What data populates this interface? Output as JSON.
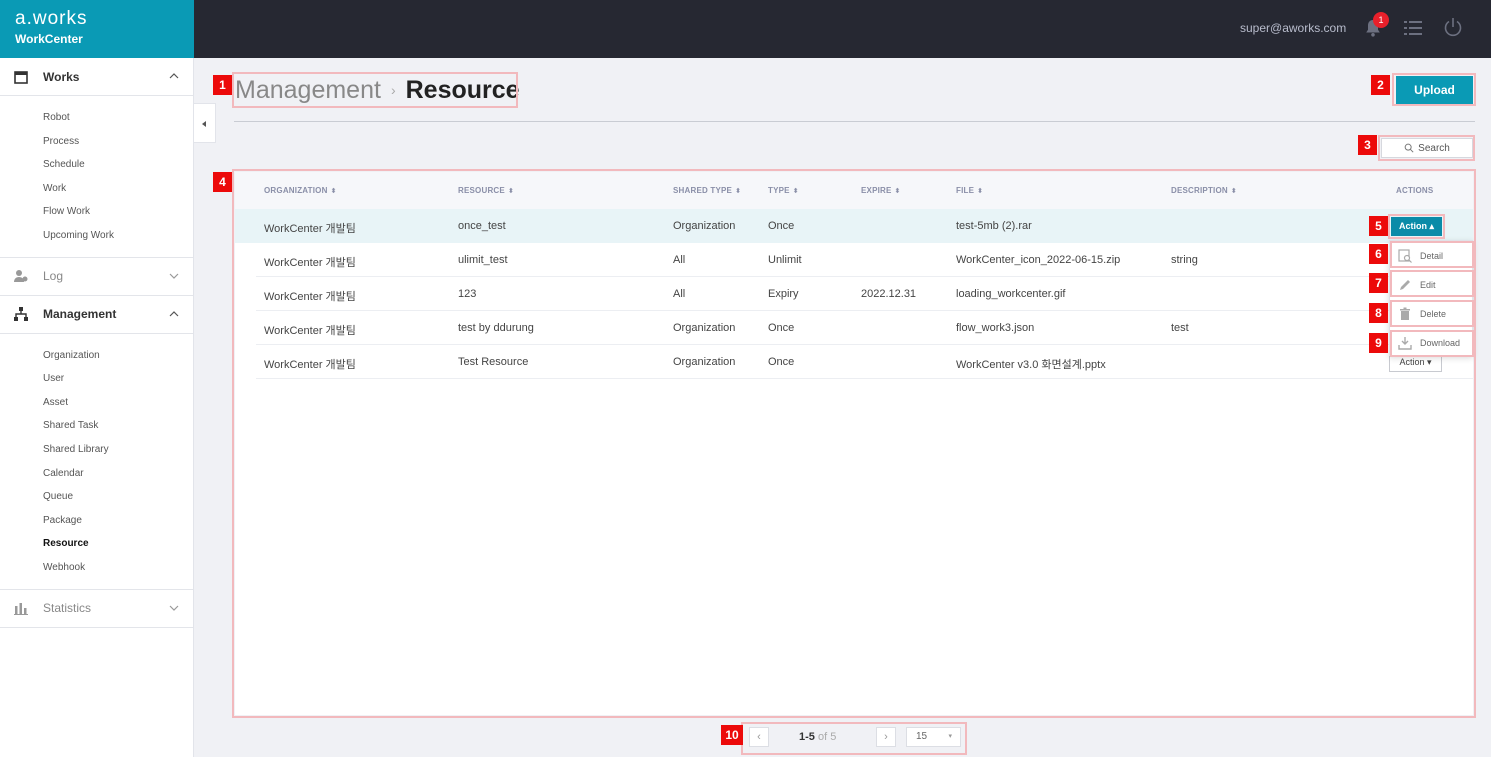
{
  "header": {
    "brand": "a.works",
    "app_name": "WorkCenter",
    "user_email": "super@aworks.com",
    "notification_count": "1"
  },
  "sidebar": {
    "sections": [
      {
        "label": "Works",
        "icon": "calendar-icon",
        "expanded": true,
        "items": [
          "Robot",
          "Process",
          "Schedule",
          "Work",
          "Flow Work",
          "Upcoming Work"
        ]
      },
      {
        "label": "Log",
        "icon": "user-log-icon",
        "expanded": false,
        "items": []
      },
      {
        "label": "Management",
        "icon": "hierarchy-icon",
        "expanded": true,
        "items": [
          "Organization",
          "User",
          "Asset",
          "Shared Task",
          "Shared Library",
          "Calendar",
          "Queue",
          "Package",
          "Resource",
          "Webhook"
        ]
      },
      {
        "label": "Statistics",
        "icon": "bar-chart-icon",
        "expanded": false,
        "items": []
      }
    ],
    "active_item": "Resource"
  },
  "page": {
    "breadcrumb_parent": "Management",
    "breadcrumb_current": "Resource",
    "upload_label": "Upload",
    "search_label": "Search"
  },
  "table": {
    "columns": [
      "ORGANIZATION",
      "RESOURCE",
      "SHARED TYPE",
      "TYPE",
      "EXPIRE",
      "FILE",
      "DESCRIPTION",
      "ACTIONS"
    ],
    "rows": [
      {
        "organization": "WorkCenter 개발팀",
        "resource": "once_test",
        "shared_type": "Organization",
        "type": "Once",
        "expire": "",
        "file": "test-5mb (2).rar",
        "description": ""
      },
      {
        "organization": "WorkCenter 개발팀",
        "resource": "ulimit_test",
        "shared_type": "All",
        "type": "Unlimit",
        "expire": "",
        "file": "WorkCenter_icon_2022-06-15.zip",
        "description": "string"
      },
      {
        "organization": "WorkCenter 개발팀",
        "resource": "123",
        "shared_type": "All",
        "type": "Expiry",
        "expire": "2022.12.31",
        "file": "loading_workcenter.gif",
        "description": ""
      },
      {
        "organization": "WorkCenter 개발팀",
        "resource": "test by ddurung",
        "shared_type": "Organization",
        "type": "Once",
        "expire": "",
        "file": "flow_work3.json",
        "description": "test"
      },
      {
        "organization": "WorkCenter 개발팀",
        "resource": "Test Resource",
        "shared_type": "Organization",
        "type": "Once",
        "expire": "",
        "file": "WorkCenter v3.0 화면설계.pptx",
        "description": ""
      }
    ],
    "action_label": "Action",
    "action_menu": [
      "Detail",
      "Edit",
      "Delete",
      "Download"
    ]
  },
  "pagination": {
    "range": "1-5",
    "of_text": "of 5",
    "page_size": "15"
  },
  "annotations": [
    "1",
    "2",
    "3",
    "4",
    "5",
    "6",
    "7",
    "8",
    "9",
    "10"
  ],
  "colors": {
    "brand": "#0a9ab5",
    "topbar": "#262832",
    "annotation_red": "#ec0a0a",
    "annotation_outline": "#f2b9bd"
  }
}
